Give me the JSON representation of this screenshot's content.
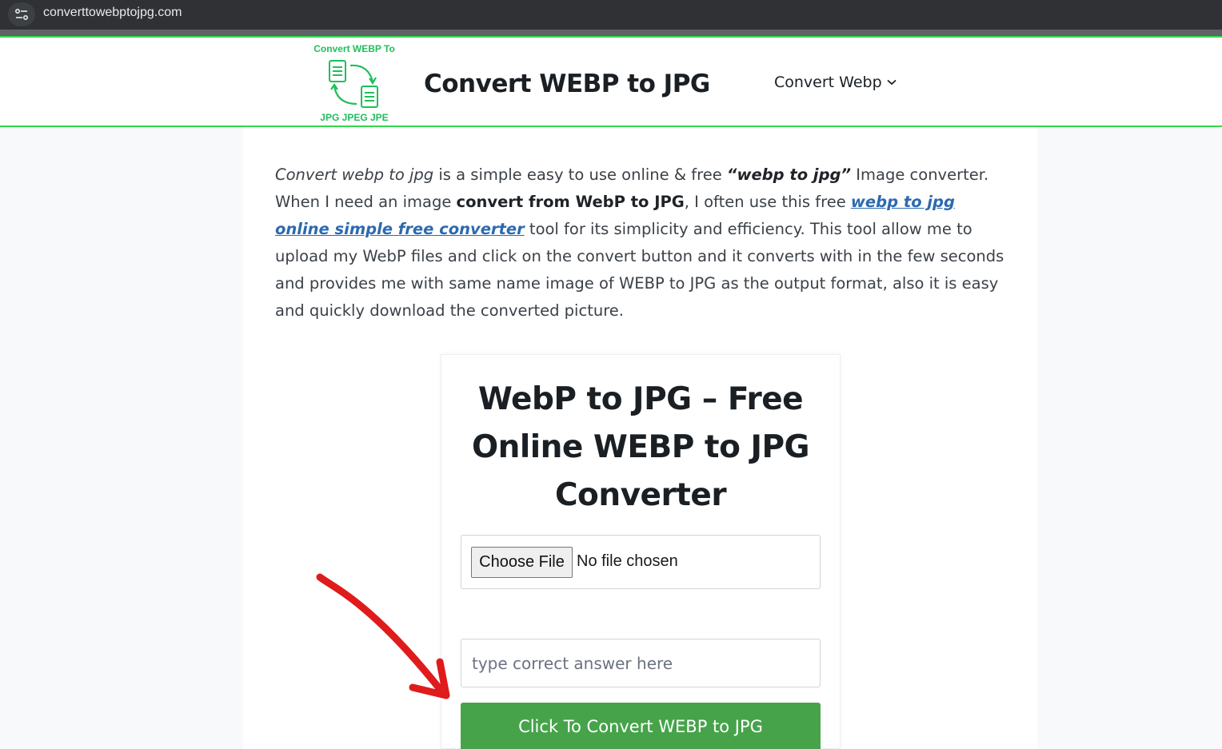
{
  "browser": {
    "url": "converttowebptojpg.com"
  },
  "header": {
    "logo_top_text": "Convert WEBP To",
    "logo_bottom_text": "JPG JPEG JPE",
    "site_title": "Convert WEBP to JPG",
    "nav_label": "Convert Webp"
  },
  "intro": {
    "p1_italic": "Convert webp to jpg",
    "p2": " is a simple easy to use online & free ",
    "p3_bold_italic": "“webp to jpg”",
    "p4": " Image converter. When I need an image ",
    "p5_bold": "convert from WebP to JPG",
    "p6": ", I often use this free ",
    "p7_link": "webp to jpg online simple free converter",
    "p8": " tool for its simplicity and efficiency. This tool allow me to upload my WebP files and click on the convert button and it converts with in the few seconds and provides me with same name image of WEBP to JPG as the output format, also it is easy and quickly download the converted picture."
  },
  "converter": {
    "heading_line1": "WebP to JPG – Free",
    "heading_line2": "Online WEBP to JPG",
    "heading_line3": "Converter",
    "choose_file_label": "Choose File",
    "no_file_text": "No file chosen",
    "answer_placeholder": "type correct answer here",
    "convert_button_label": "Click To Convert WEBP to JPG"
  },
  "colors": {
    "accent_green": "#32d84a",
    "button_green": "#46a34a",
    "link_blue": "#2b6ab0",
    "annotation_red": "#e01b1b"
  }
}
